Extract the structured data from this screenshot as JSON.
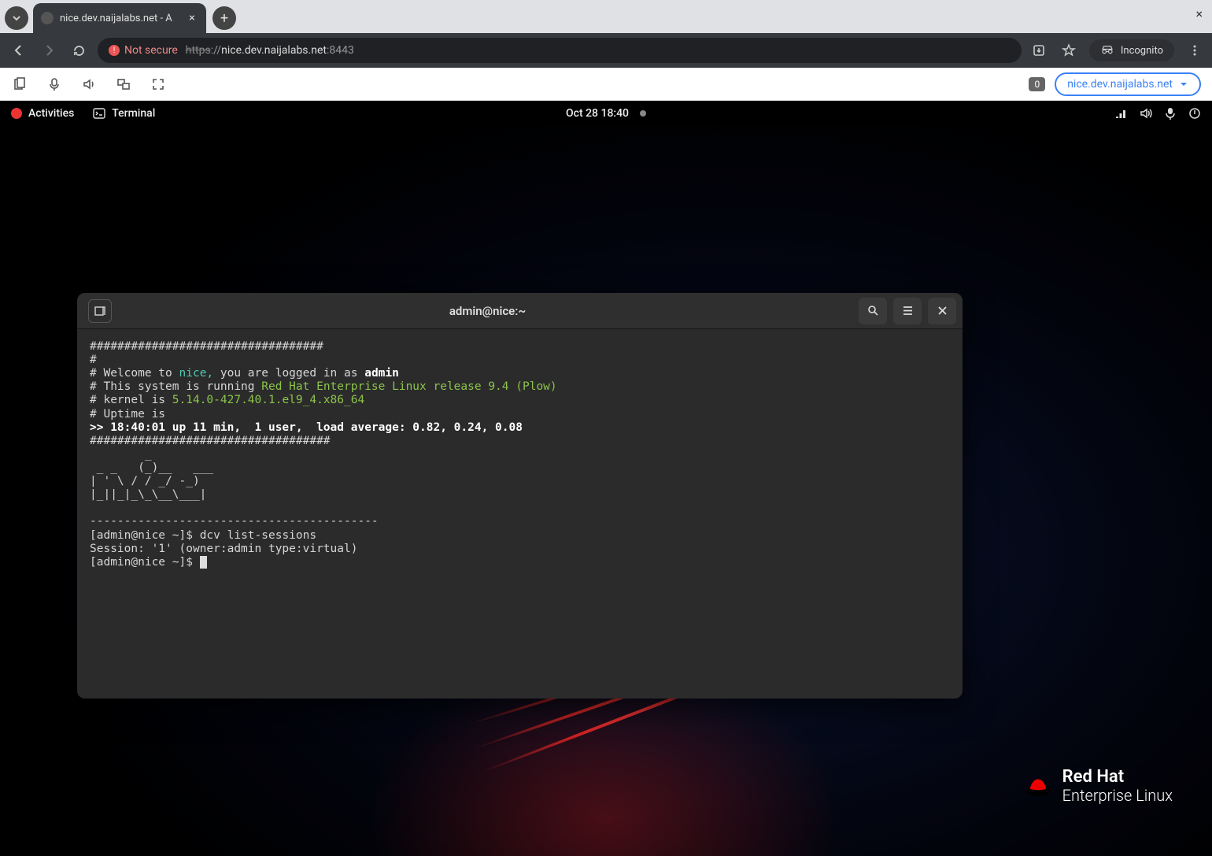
{
  "browser": {
    "tab_title": "nice.dev.naijalabs.net - A",
    "new_tab_label": "+",
    "close_tab_label": "×",
    "window_close_label": "×",
    "not_secure_label": "Not secure",
    "url_protocol": "https",
    "url_host": "nice.dev.naijalabs.net",
    "url_port": ":8443",
    "incognito_label": "Incognito"
  },
  "dcv": {
    "badge_count": "0",
    "host_label": "nice.dev.naijalabs.net"
  },
  "gnome": {
    "activities": "Activities",
    "app_name": "Terminal",
    "clock": "Oct 28  18:40"
  },
  "terminal": {
    "title": "admin@nice:~",
    "motd_hash1": "##################################",
    "motd_hash2": "###################################",
    "welcome_pre": "# Welcome to ",
    "welcome_host": "nice,",
    "welcome_mid": " you are logged in as ",
    "welcome_user": "admin",
    "os_pre": "# This system is running ",
    "os_name": "Red Hat Enterprise Linux release 9.4 (Plow)",
    "kernel_pre": "# kernel is ",
    "kernel_ver": "5.14.0-427.40.1.el9_4.x86_64",
    "uptime_label": "# Uptime is",
    "uptime_line": ">> 18:40:01 up 11 min,  1 user,  load average: 0.82, 0.24, 0.08",
    "ascii1": "        _         ",
    "ascii2": " _ _   (_)__   ___",
    "ascii3": "| ' \\ / / _/ -_)",
    "ascii4": "|_||_|_\\_\\__\\___|",
    "divider": "------------------------------------------",
    "prompt1": "[admin@nice ~]$ ",
    "cmd1": "dcv list-sessions",
    "output1": "Session: '1' (owner:admin type:virtual)",
    "prompt2": "[admin@nice ~]$ "
  },
  "rh": {
    "line1": "Red Hat",
    "line2": "Enterprise Linux"
  }
}
